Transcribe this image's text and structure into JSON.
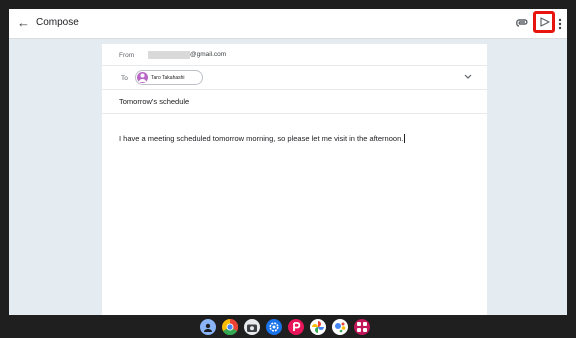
{
  "app_bar": {
    "back_glyph": "←",
    "title": "Compose",
    "icons": [
      "back-arrow-icon",
      "attachment-icon",
      "send-icon",
      "more-vert-icon"
    ],
    "highlight_color": "#e8150f"
  },
  "compose": {
    "from_label": "From",
    "from_email_domain": "@gmail.com",
    "to_label": "To",
    "to_recipient": "Taro Takahashi",
    "subject": "Tomorrow's schedule",
    "body": "I have a meeting scheduled tomorrow morning, so please let me visit in the afternoon."
  },
  "shelf": {
    "apps": [
      {
        "name": "launcher-icon",
        "color": "#8ab4f8"
      },
      {
        "name": "chrome-icon",
        "color": "#fbbc04"
      },
      {
        "name": "camera-icon",
        "color": "#e8eaed"
      },
      {
        "name": "settings-icon",
        "color": "#1a73e8"
      },
      {
        "name": "paypay-icon",
        "color": "#e8155a"
      },
      {
        "name": "photos-icon",
        "color": "#34a853"
      },
      {
        "name": "assistant-icon",
        "color": "#4285f4"
      },
      {
        "name": "apps-icon",
        "color": "#c2185b"
      }
    ]
  },
  "colors": {
    "screen_background": "#e4ecf1",
    "device_frame": "#1f1f1f"
  }
}
